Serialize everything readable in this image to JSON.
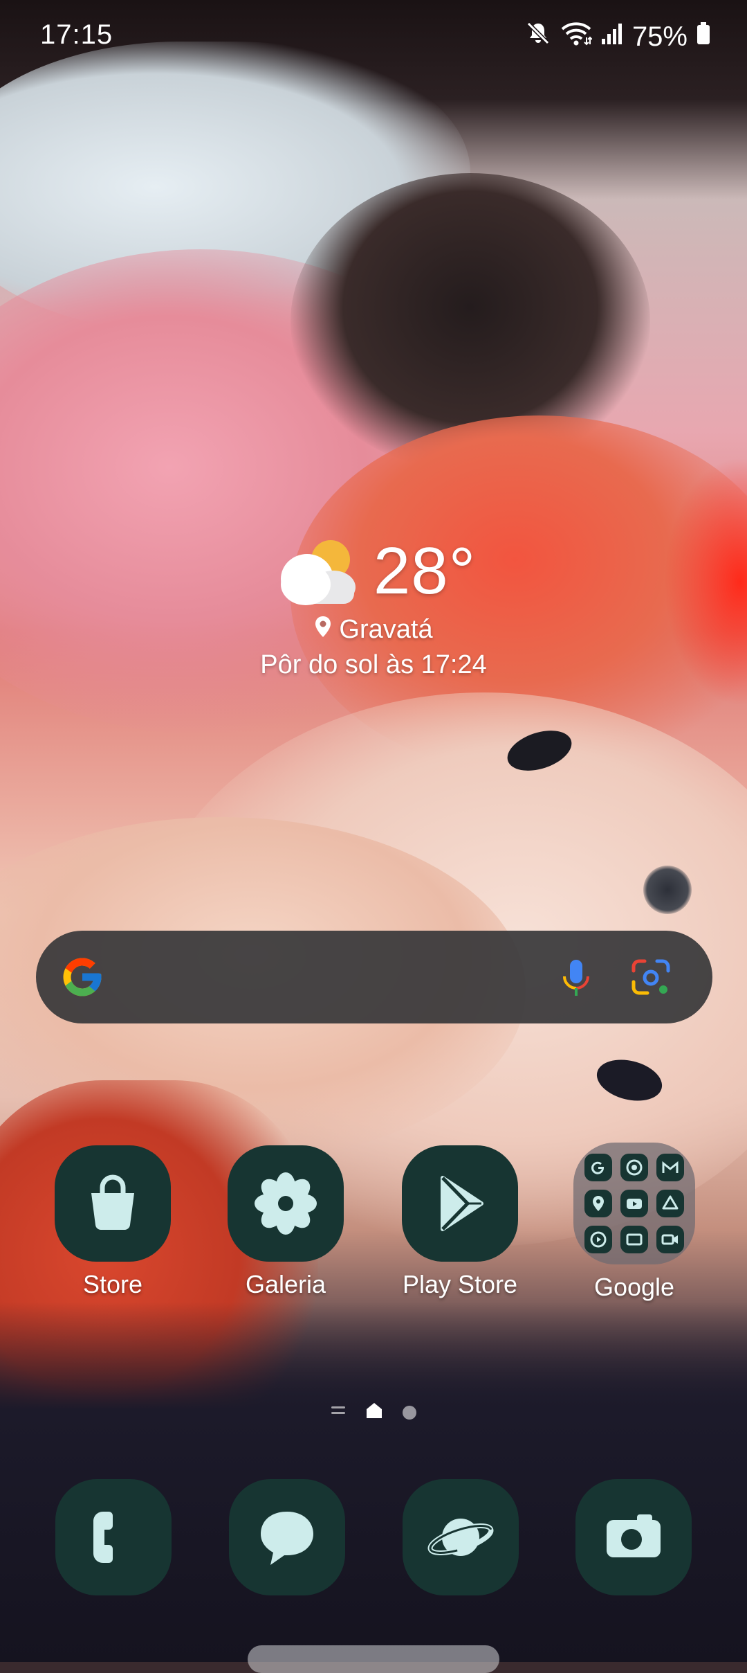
{
  "status_bar": {
    "time": "17:15",
    "battery_percent": "75%",
    "icons": [
      "mute-icon",
      "wifi-icon",
      "signal-icon",
      "battery-icon"
    ]
  },
  "weather": {
    "temperature": "28°",
    "location": "Gravatá",
    "sunset": "Pôr do sol às 17:24",
    "condition_icon": "partly-cloudy-icon"
  },
  "search": {
    "logo_icon": "google-g-icon",
    "mic_icon": "mic-icon",
    "lens_icon": "google-lens-icon"
  },
  "apps": [
    {
      "label": "Store",
      "icon": "shopping-bag-icon"
    },
    {
      "label": "Galeria",
      "icon": "flower-icon"
    },
    {
      "label": "Play Store",
      "icon": "play-store-icon"
    },
    {
      "label": "Google",
      "icon": "folder-icon"
    }
  ],
  "folder_apps": [
    "google-icon",
    "chrome-icon",
    "gmail-icon",
    "maps-icon",
    "youtube-icon",
    "drive-icon",
    "youtube-music-icon",
    "tv-icon",
    "meet-icon"
  ],
  "page_indicator": {
    "pages": 2,
    "current": 1
  },
  "dock": [
    {
      "icon": "phone-icon"
    },
    {
      "icon": "messages-icon"
    },
    {
      "icon": "internet-icon"
    },
    {
      "icon": "camera-icon"
    }
  ],
  "colors": {
    "icon_tile": "#173532",
    "icon_glyph": "#cdeceb",
    "search_bar": "#37373a"
  }
}
